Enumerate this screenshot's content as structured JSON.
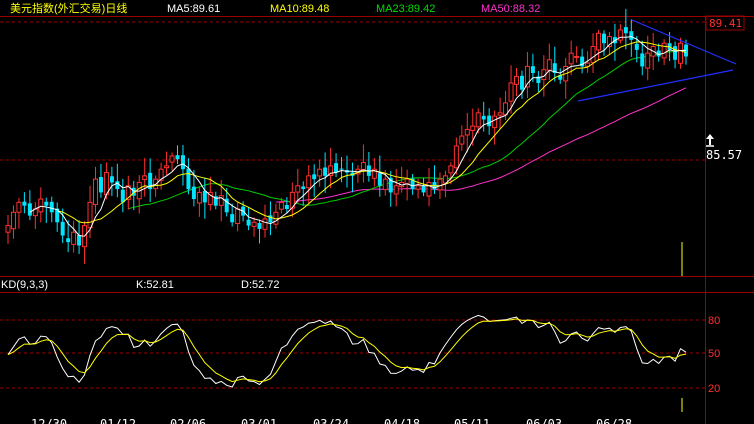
{
  "header": {
    "title": "美元指数(外汇交易)日线",
    "ma5": "MA5:89.61",
    "ma10": "MA10:89.48",
    "ma23": "MA23:89.42",
    "ma50": "MA50:88.32"
  },
  "price_axis": {
    "top_label": "89.41",
    "mid_label": "85.57"
  },
  "kd_header": {
    "name": "KD(9,3,3)",
    "k": "K:52.81",
    "d": "D:52.72"
  },
  "kd_axis": {
    "labels": [
      "80",
      "50",
      "20"
    ]
  },
  "date_labels": [
    "12/30",
    "01/12",
    "02/06",
    "03/01",
    "03/24",
    "04/18",
    "05/11",
    "06/03",
    "06/28"
  ],
  "colors": {
    "up": "#ff3030",
    "down": "#00e5ff",
    "ma5": "#ffffff",
    "ma10": "#ffff00",
    "ma23": "#00cc00",
    "ma50": "#ff33cc",
    "trend": "#2030ff",
    "grid": "#9a0000",
    "title": "#ffff00",
    "k": "#ffffff",
    "d": "#ffff00"
  },
  "chart_data": [
    {
      "type": "candlestick",
      "title": "美元指数(外汇交易)日线",
      "series": [
        {
          "name": "MA5",
          "last": 89.61
        },
        {
          "name": "MA10",
          "last": 89.48
        },
        {
          "name": "MA23",
          "last": 89.42
        },
        {
          "name": "MA50",
          "last": 88.32
        }
      ],
      "ylim": [
        82.5,
        90.1
      ],
      "y_reference_lines": [
        85.57,
        89.41
      ],
      "close": [
        83.9,
        84.3,
        84.6,
        84.5,
        84.2,
        84.4,
        84.7,
        84.5,
        84.3,
        84.0,
        83.6,
        83.4,
        83.7,
        83.3,
        83.9,
        84.6,
        85.3,
        84.9,
        85.5,
        85.2,
        85.0,
        84.6,
        85.1,
        84.8,
        85.2,
        85.4,
        85.0,
        85.3,
        85.6,
        85.7,
        86.0,
        85.9,
        85.6,
        85.0,
        84.7,
        84.9,
        84.6,
        84.9,
        84.5,
        84.8,
        84.3,
        84.0,
        84.4,
        84.2,
        83.9,
        84.0,
        83.8,
        84.1,
        84.0,
        84.3,
        84.6,
        84.4,
        84.9,
        85.1,
        85.0,
        85.4,
        85.3,
        85.6,
        85.4,
        85.7,
        85.5,
        85.6,
        85.5,
        85.4,
        85.6,
        85.8,
        85.4,
        85.6,
        85.1,
        85.3,
        84.9,
        85.1,
        85.2,
        85.3,
        85.0,
        85.1,
        84.9,
        85.2,
        85.0,
        85.3,
        85.4,
        85.7,
        86.3,
        86.6,
        86.8,
        86.9,
        87.3,
        87.1,
        86.9,
        87.2,
        87.3,
        87.6,
        88.2,
        88.4,
        88.0,
        88.7,
        88.5,
        88.2,
        88.6,
        88.9,
        88.5,
        88.3,
        88.7,
        89.1,
        89.0,
        88.7,
        88.8,
        89.3,
        89.7,
        89.4,
        89.6,
        89.4,
        89.8,
        89.7,
        89.5,
        89.2,
        88.7,
        89.1,
        89.3,
        89.0,
        89.4,
        89.2,
        88.9,
        89.4,
        89.0
      ],
      "last_close": 89.0
    },
    {
      "type": "line",
      "title": "KD(9,3,3)",
      "series": [
        {
          "name": "K",
          "last": 52.81
        },
        {
          "name": "D",
          "last": 52.72
        }
      ],
      "ylim": [
        0,
        105
      ],
      "y_reference_lines": [
        20,
        50,
        80
      ]
    }
  ]
}
